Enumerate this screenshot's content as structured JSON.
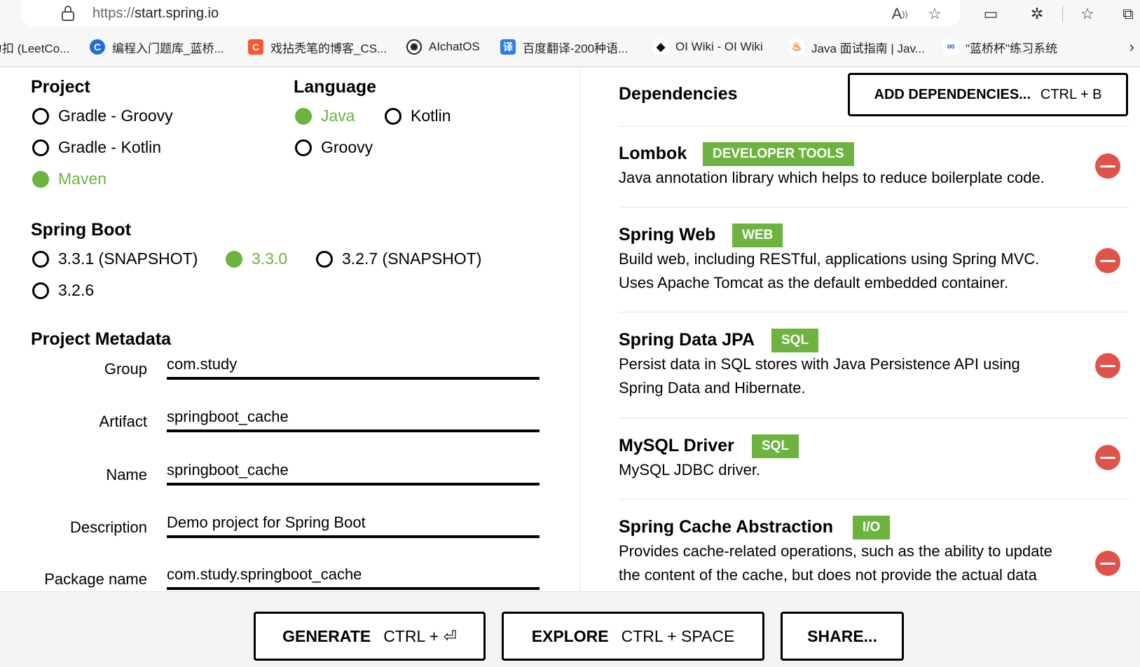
{
  "browser": {
    "url_protocol": "https://",
    "url_host": "start.spring.io",
    "bookmarks": [
      {
        "label": "力扣 (LeetCo...",
        "icon": "leetcode-icon"
      },
      {
        "label": "编程入门题库_蓝桥...",
        "icon": "lanqiao-icon"
      },
      {
        "label": "戏拈秃笔的博客_CS...",
        "icon": "csdn-icon"
      },
      {
        "label": "AIchatOS",
        "icon": "chat-icon"
      },
      {
        "label": "百度翻译-200种语...",
        "icon": "translate-icon"
      },
      {
        "label": "OI Wiki - OI Wiki",
        "icon": "oiwiki-icon"
      },
      {
        "label": "Java 面试指南 | Jav...",
        "icon": "java-icon"
      },
      {
        "label": "\"蓝桥杯\"练习系统",
        "icon": "lanqiao-system-icon"
      }
    ]
  },
  "project": {
    "title": "Project",
    "options": [
      {
        "label": "Gradle - Groovy",
        "selected": false
      },
      {
        "label": "Gradle - Kotlin",
        "selected": false
      },
      {
        "label": "Maven",
        "selected": true
      }
    ]
  },
  "language": {
    "title": "Language",
    "options": [
      {
        "label": "Java",
        "selected": true
      },
      {
        "label": "Kotlin",
        "selected": false
      },
      {
        "label": "Groovy",
        "selected": false
      }
    ]
  },
  "spring_boot": {
    "title": "Spring Boot",
    "options": [
      {
        "label": "3.3.1 (SNAPSHOT)",
        "selected": false
      },
      {
        "label": "3.3.0",
        "selected": true
      },
      {
        "label": "3.2.7 (SNAPSHOT)",
        "selected": false
      },
      {
        "label": "3.2.6",
        "selected": false
      }
    ]
  },
  "metadata": {
    "title": "Project Metadata",
    "fields": [
      {
        "label": "Group",
        "value": "com.study"
      },
      {
        "label": "Artifact",
        "value": "springboot_cache"
      },
      {
        "label": "Name",
        "value": "springboot_cache"
      },
      {
        "label": "Description",
        "value": "Demo project for Spring Boot"
      },
      {
        "label": "Package name",
        "value": "com.study.springboot_cache"
      }
    ]
  },
  "dependencies": {
    "title": "Dependencies",
    "add_label": "ADD DEPENDENCIES...",
    "add_shortcut": "CTRL + B",
    "items": [
      {
        "name": "Lombok",
        "tag": "DEVELOPER TOOLS",
        "description": "Java annotation library which helps to reduce boilerplate code."
      },
      {
        "name": "Spring Web",
        "tag": "WEB",
        "description": "Build web, including RESTful, applications using Spring MVC. Uses Apache Tomcat as the default embedded container."
      },
      {
        "name": "Spring Data JPA",
        "tag": "SQL",
        "description": "Persist data in SQL stores with Java Persistence API using Spring Data and Hibernate."
      },
      {
        "name": "MySQL Driver",
        "tag": "SQL",
        "description": "MySQL JDBC driver."
      },
      {
        "name": "Spring Cache Abstraction",
        "tag": "I/O",
        "description": "Provides cache-related operations, such as the ability to update the content of the cache, but does not provide the actual data"
      }
    ]
  },
  "footer": {
    "generate_label": "GENERATE",
    "generate_shortcut": "CTRL + ⏎",
    "explore_label": "EXPLORE",
    "explore_shortcut": "CTRL + SPACE",
    "share_label": "SHARE..."
  },
  "colors": {
    "accent": "#6db33f",
    "remove": "#e0534a"
  }
}
